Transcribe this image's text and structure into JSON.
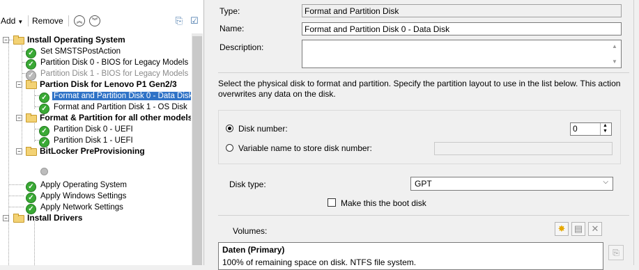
{
  "toolbar": {
    "add": "Add",
    "remove": "Remove"
  },
  "tree": [
    {
      "label": "Install Operating System",
      "kind": "group"
    },
    {
      "label": "Set SMSTSPostAction",
      "kind": "step"
    },
    {
      "label": "Partition Disk 0 - BIOS for Legacy Models",
      "kind": "step"
    },
    {
      "label": "Partition Disk 1 - BIOS for Legacy Models",
      "kind": "step",
      "state": "disabled"
    },
    {
      "label": "Partion Disk for Lenovo P1 Gen2/3",
      "kind": "group"
    },
    {
      "label": "Format and Partition Disk 0 - Data Disk",
      "kind": "step",
      "state": "selected"
    },
    {
      "label": "Format and Partition Disk 1 - OS Disk",
      "kind": "step"
    },
    {
      "label": "Format & Partition for all other models",
      "kind": "group"
    },
    {
      "label": "Partition Disk 0 - UEFI",
      "kind": "step"
    },
    {
      "label": "Partition Disk 1 - UEFI",
      "kind": "step"
    },
    {
      "label": "BitLocker PreProvisioning",
      "kind": "group"
    },
    {
      "label": "Apply Operating System",
      "kind": "step"
    },
    {
      "label": "Apply Windows Settings",
      "kind": "step"
    },
    {
      "label": "Apply Network Settings",
      "kind": "step"
    },
    {
      "label": "Install Drivers",
      "kind": "group"
    }
  ],
  "props": {
    "type_label": "Type:",
    "type_value": "Format and Partition Disk",
    "name_label": "Name:",
    "name_value": "Format and Partition Disk 0 - Data Disk",
    "desc_label": "Description:",
    "info": "Select the physical disk to format and partition. Specify the partition layout to use in the list below. This action overwrites any data on the disk.",
    "disk_number_label": "Disk number:",
    "disk_number_value": "0",
    "variable_label": "Variable name to store disk number:",
    "disk_type_label": "Disk type:",
    "disk_type_value": "GPT",
    "boot_disk_label": "Make this the boot disk",
    "volumes_label": "Volumes:",
    "volume_name": "Daten (Primary)",
    "volume_desc": "100% of remaining space on disk. NTFS file system."
  },
  "colors": {
    "selection": "#2e72c6",
    "ok_green": "#3aa935",
    "folder": "#f3d274"
  }
}
